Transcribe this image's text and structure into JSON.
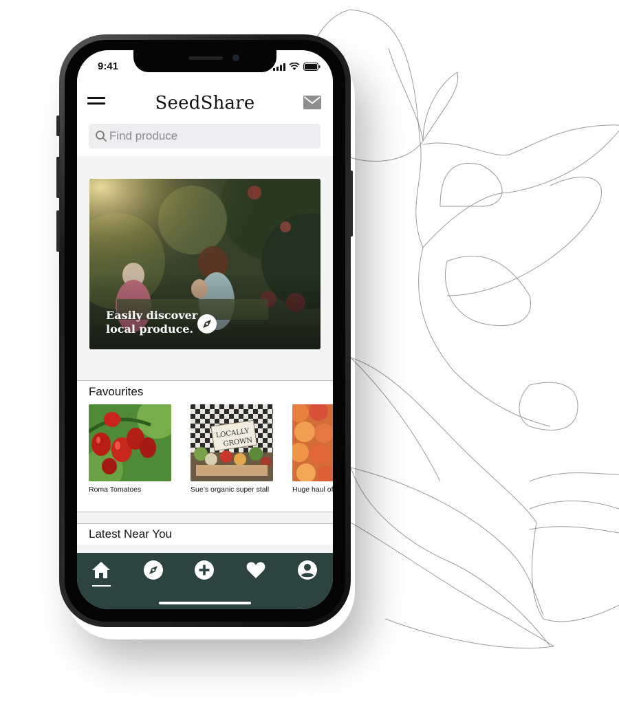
{
  "status_bar": {
    "time": "9:41"
  },
  "app": {
    "brand": "SeedShare"
  },
  "search": {
    "placeholder": "Find produce"
  },
  "hero": {
    "line1": "Easily discover",
    "line2": "local produce."
  },
  "favourites": {
    "title": "Favourites",
    "items": [
      {
        "caption": "Roma Tomatoes"
      },
      {
        "caption": "Sue’s organic super stall",
        "sign_line1": "LOCALLY",
        "sign_line2": "GROWN"
      },
      {
        "caption": "Huge haul of Nectarines"
      }
    ]
  },
  "latest": {
    "title": "Latest Near You"
  },
  "tabs": [
    "home-icon",
    "compass-icon",
    "add-icon",
    "heart-icon",
    "account-icon"
  ],
  "colors": {
    "tabbar": "#2c4340",
    "accent_white": "#ffffff",
    "screen_bg": "#f4f4f4"
  }
}
